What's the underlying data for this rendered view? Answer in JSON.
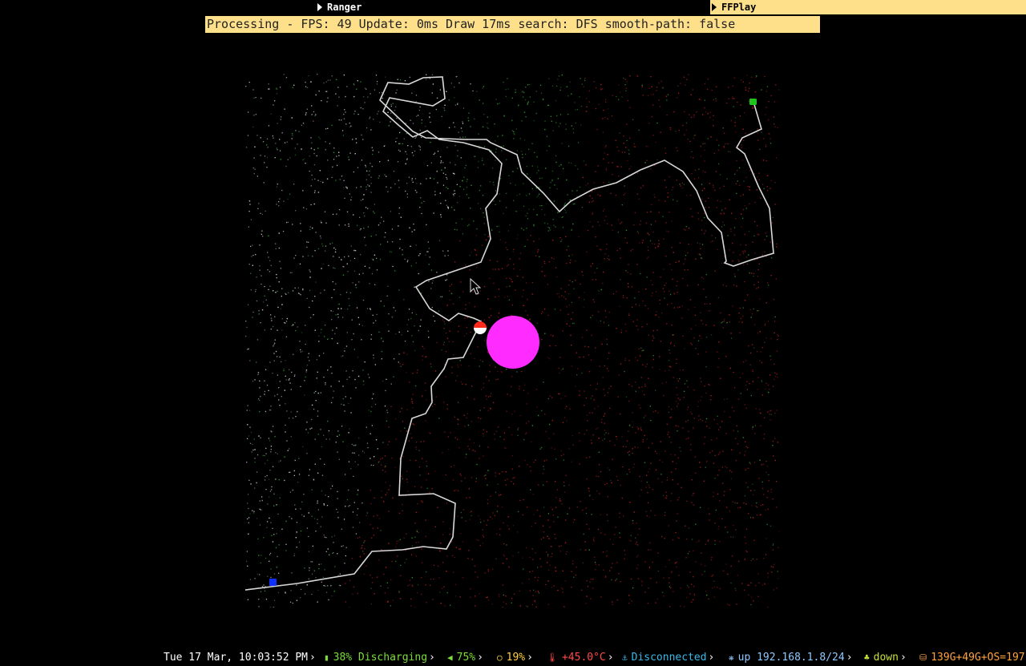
{
  "tabs": [
    {
      "label": "Ranger",
      "active": false
    },
    {
      "label": "FFPlay",
      "active": true
    }
  ],
  "window": {
    "title": "Processing - FPS: 49 Update: 0ms Draw 17ms search: DFS smooth-path: false"
  },
  "simulation": {
    "search": "DFS",
    "smooth_path": "false",
    "fps": 49,
    "colors": {
      "path": "#d8d8d8",
      "visited_dots": "#2f8a2f",
      "unvisited_dots_left": "#bdbdbd",
      "unvisited_dots_right": "#a11c1c",
      "goal": "#1fc41f",
      "start": "#1030ff",
      "obstacle": "#ff2bff",
      "agent_top": "#ff2a1a",
      "agent_bottom": "#ffffff"
    }
  },
  "statusbar": {
    "datetime": "Tue 17 Mar, 10:03:52 PM",
    "battery": "38% Discharging",
    "volume": "75%",
    "brightness": "19%",
    "temperature": "+45.0°C",
    "vpn": "Disconnected",
    "net_up": "up 192.168.1.8/24",
    "net_down": "down",
    "disk": "139G+49G+OS=197",
    "separator": "›",
    "colors": {
      "battery": "#7ddc3a",
      "volume": "#7ddc3a",
      "brightness": "#ffd23c",
      "temperature": "#ff4a4a",
      "vpn": "#3ab8e6",
      "disk": "#ffa23c"
    }
  }
}
